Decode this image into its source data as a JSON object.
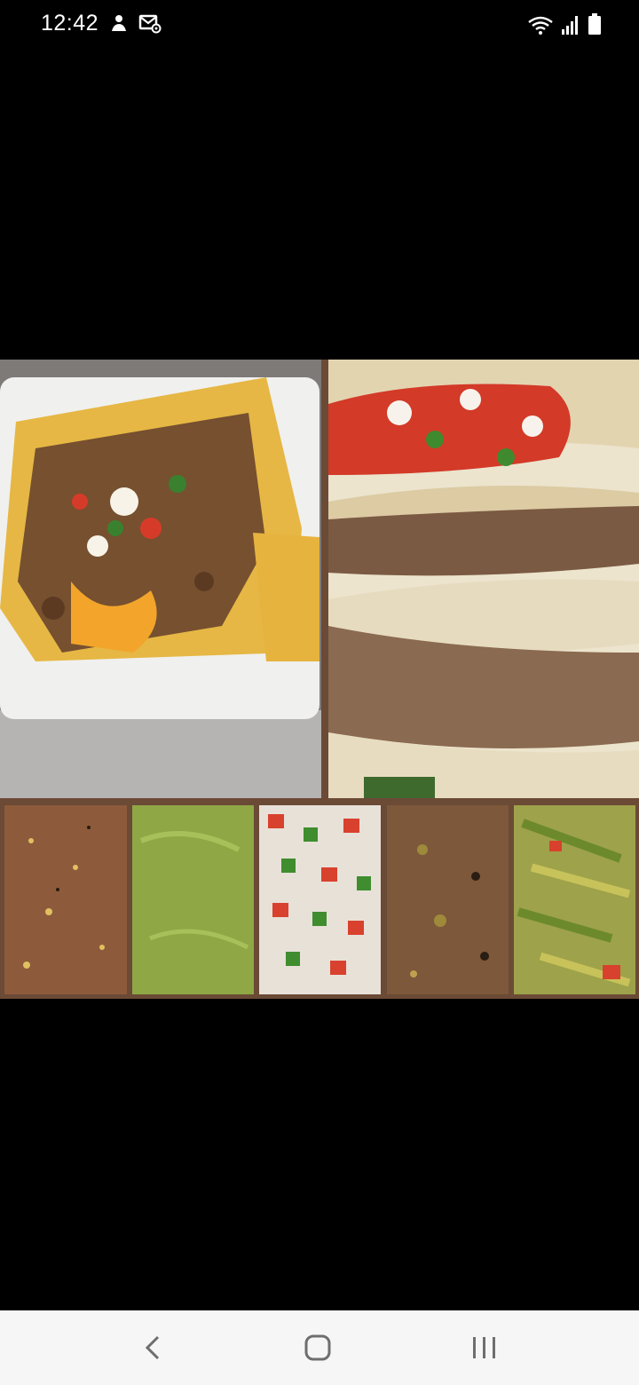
{
  "status_bar": {
    "time": "12:42",
    "left_icons": [
      "notification-person-icon",
      "mail-settings-icon"
    ],
    "right_icons": [
      "wifi-icon",
      "signal-icon",
      "battery-icon"
    ]
  },
  "image": {
    "panels": [
      {
        "name": "nachos"
      },
      {
        "name": "tacos"
      },
      {
        "name": "red-salsa"
      },
      {
        "name": "green-salsa"
      },
      {
        "name": "pico-de-gallo"
      },
      {
        "name": "chile-salsa"
      },
      {
        "name": "nopales"
      }
    ]
  },
  "nav_bar": {
    "buttons": [
      "back-icon",
      "home-icon",
      "recent-apps-icon"
    ]
  }
}
